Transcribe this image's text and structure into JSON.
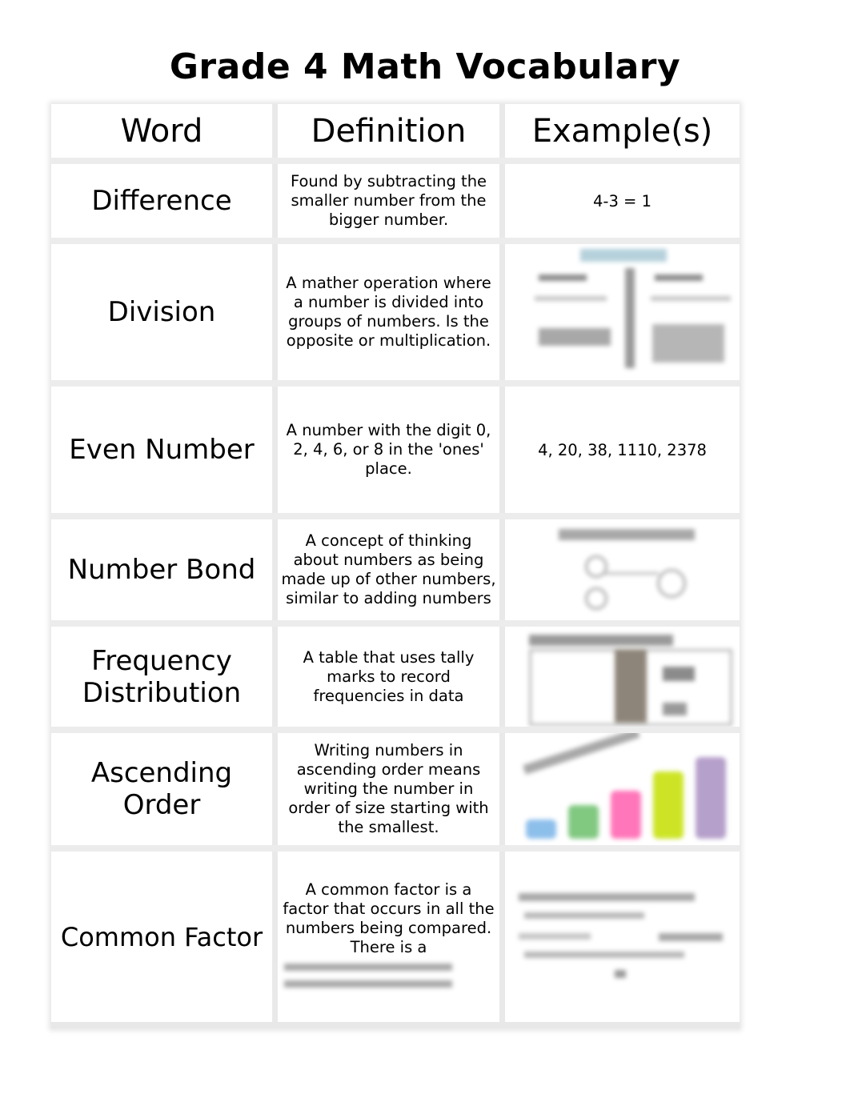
{
  "document": {
    "title": "Grade 4 Math Vocabulary",
    "headers": [
      "Word",
      "Definition",
      "Example(s)"
    ],
    "rows": [
      {
        "word": "Difference",
        "definition": "Found by subtracting the smaller number from the bigger number.",
        "example": "4-3 = 1",
        "example_type": "text"
      },
      {
        "word": "Division",
        "definition": "A mather operation where a number is divided into groups of numbers. Is the opposite or multiplication.",
        "example": "",
        "example_type": "image",
        "image_desc": "blurred division diagram"
      },
      {
        "word": "Even Number",
        "definition": "A number with the digit 0, 2, 4, 6, or 8 in the 'ones' place.",
        "example": "4, 20, 38, 1110, 2378",
        "example_type": "text"
      },
      {
        "word": "Number Bond",
        "definition": "A concept of thinking about numbers as being made up of other numbers, similar to adding numbers",
        "example": "",
        "example_type": "image",
        "image_desc": "blurred number bonds diagram"
      },
      {
        "word": "Frequency Distribution",
        "definition": "A table that uses tally marks to record frequencies in data",
        "example": "",
        "example_type": "image",
        "image_desc": "blurred frequency table"
      },
      {
        "word": "Ascending Order",
        "definition": "Writing numbers in ascending order means writing the number in order of size starting with the smallest.",
        "example": "",
        "example_type": "image",
        "image_desc": "blurred ascending bars",
        "bar_colors": [
          "#7ab4e8",
          "#6cbf6c",
          "#ff5fae",
          "#c4e000",
          "#a98fc2"
        ]
      },
      {
        "word": "Common Factor",
        "definition": "A common factor is a factor that occurs in all the numbers being compared. There is a",
        "example": "",
        "example_type": "image",
        "image_desc": "blurred common factor example"
      }
    ]
  }
}
